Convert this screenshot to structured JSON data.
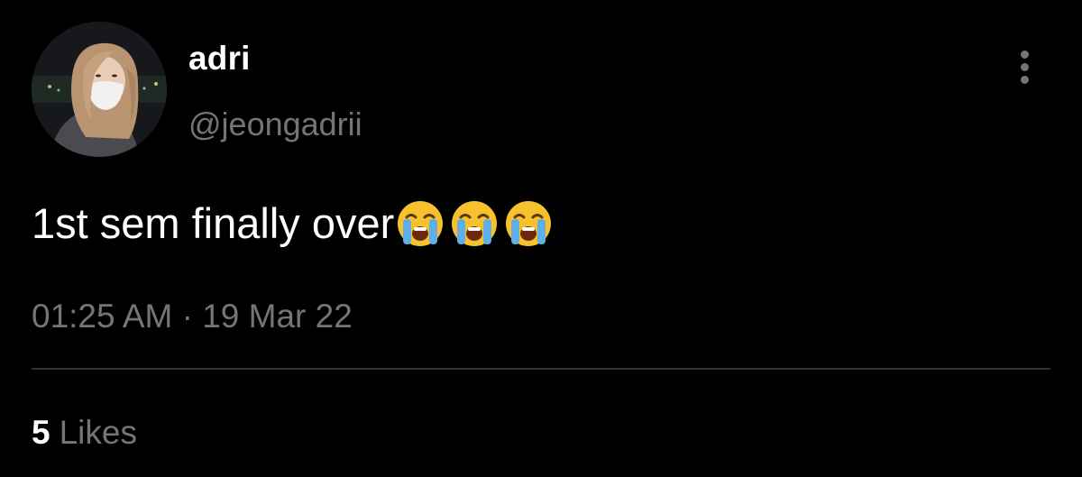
{
  "tweet": {
    "author": {
      "display_name": "adri",
      "handle": "@jeongadrii",
      "avatar_icon": "profile-photo"
    },
    "text": "1st sem finally over",
    "emojis": [
      "loudly-crying-face",
      "loudly-crying-face",
      "loudly-crying-face"
    ],
    "timestamp": "01:25 AM · 19 Mar 22",
    "likes": {
      "count": "5",
      "label": "Likes"
    },
    "more_icon": "more-vertical-icon"
  },
  "colors": {
    "background": "#000000",
    "primary_text": "#ffffff",
    "secondary_text": "#71767b",
    "divider": "#2f3336"
  }
}
